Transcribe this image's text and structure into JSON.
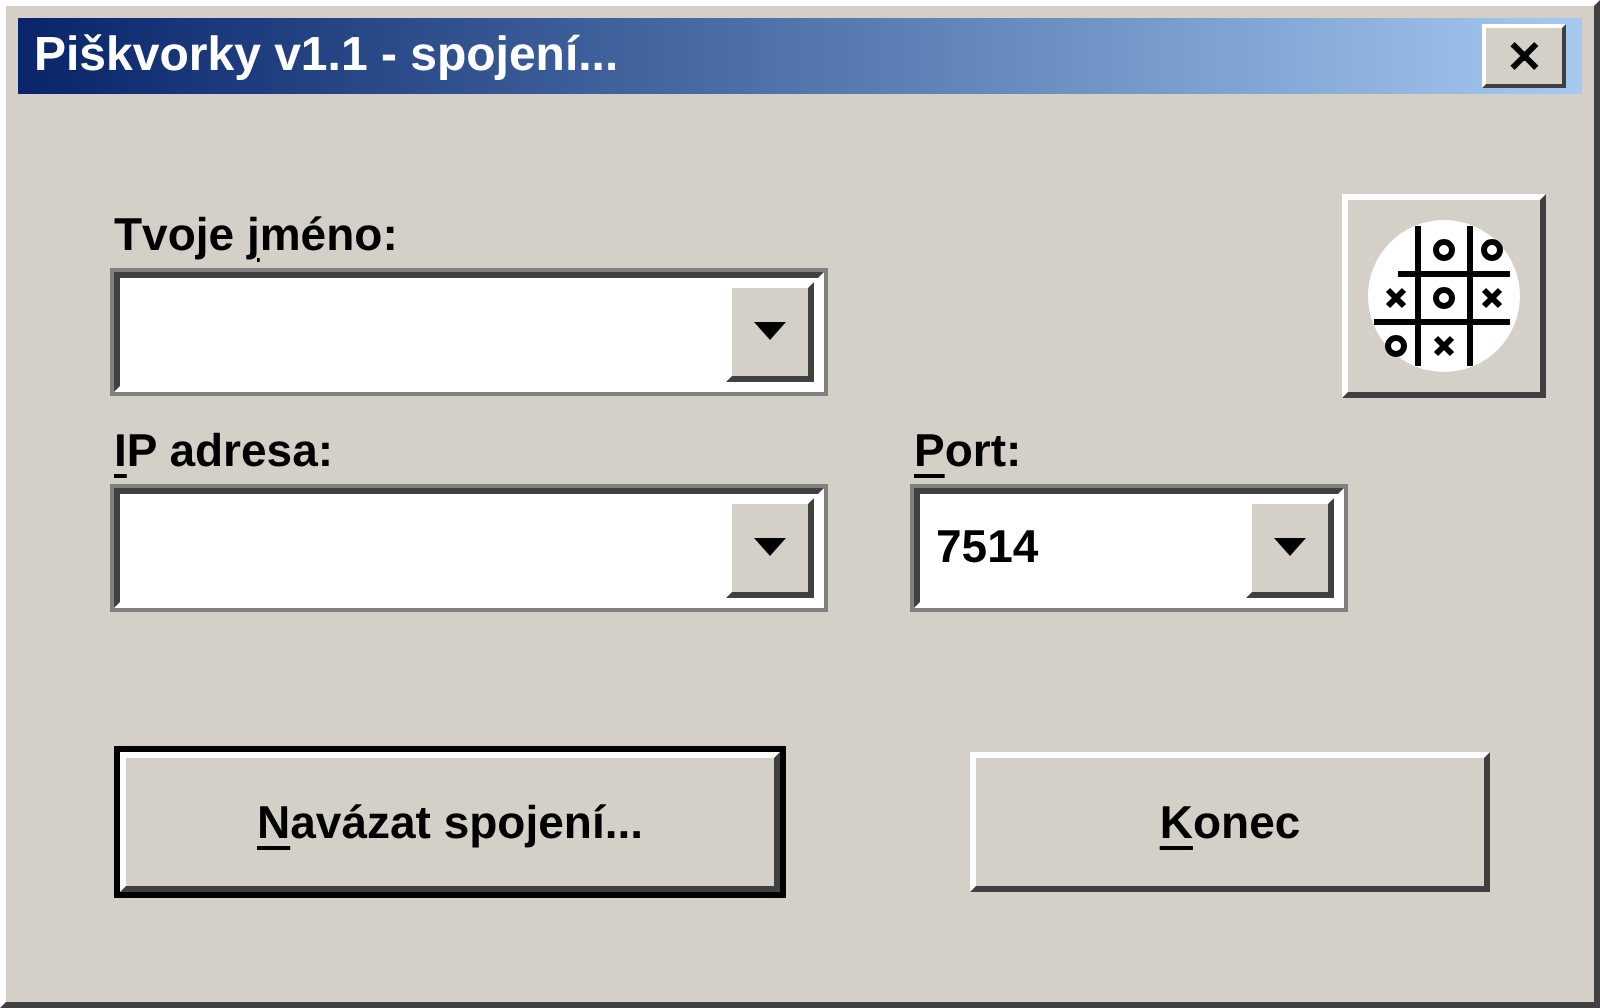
{
  "window": {
    "title": "Piškvorky v1.1 - spojení...",
    "close": "✕"
  },
  "fields": [
    {
      "label": {
        "before": "Tvoje ",
        "key": "j",
        "after": "méno:"
      }
    },
    {
      "label": {
        "key": "I",
        "after": "P adresa:"
      }
    },
    {
      "label": {
        "key": "P",
        "after": "ort:"
      },
      "value": "7514"
    }
  ],
  "buttons": [
    {
      "label": {
        "key": "N",
        "after": "avázat spojení..."
      },
      "default": true
    },
    {
      "label": {
        "key": "K",
        "after": "onec"
      },
      "default": false
    }
  ]
}
